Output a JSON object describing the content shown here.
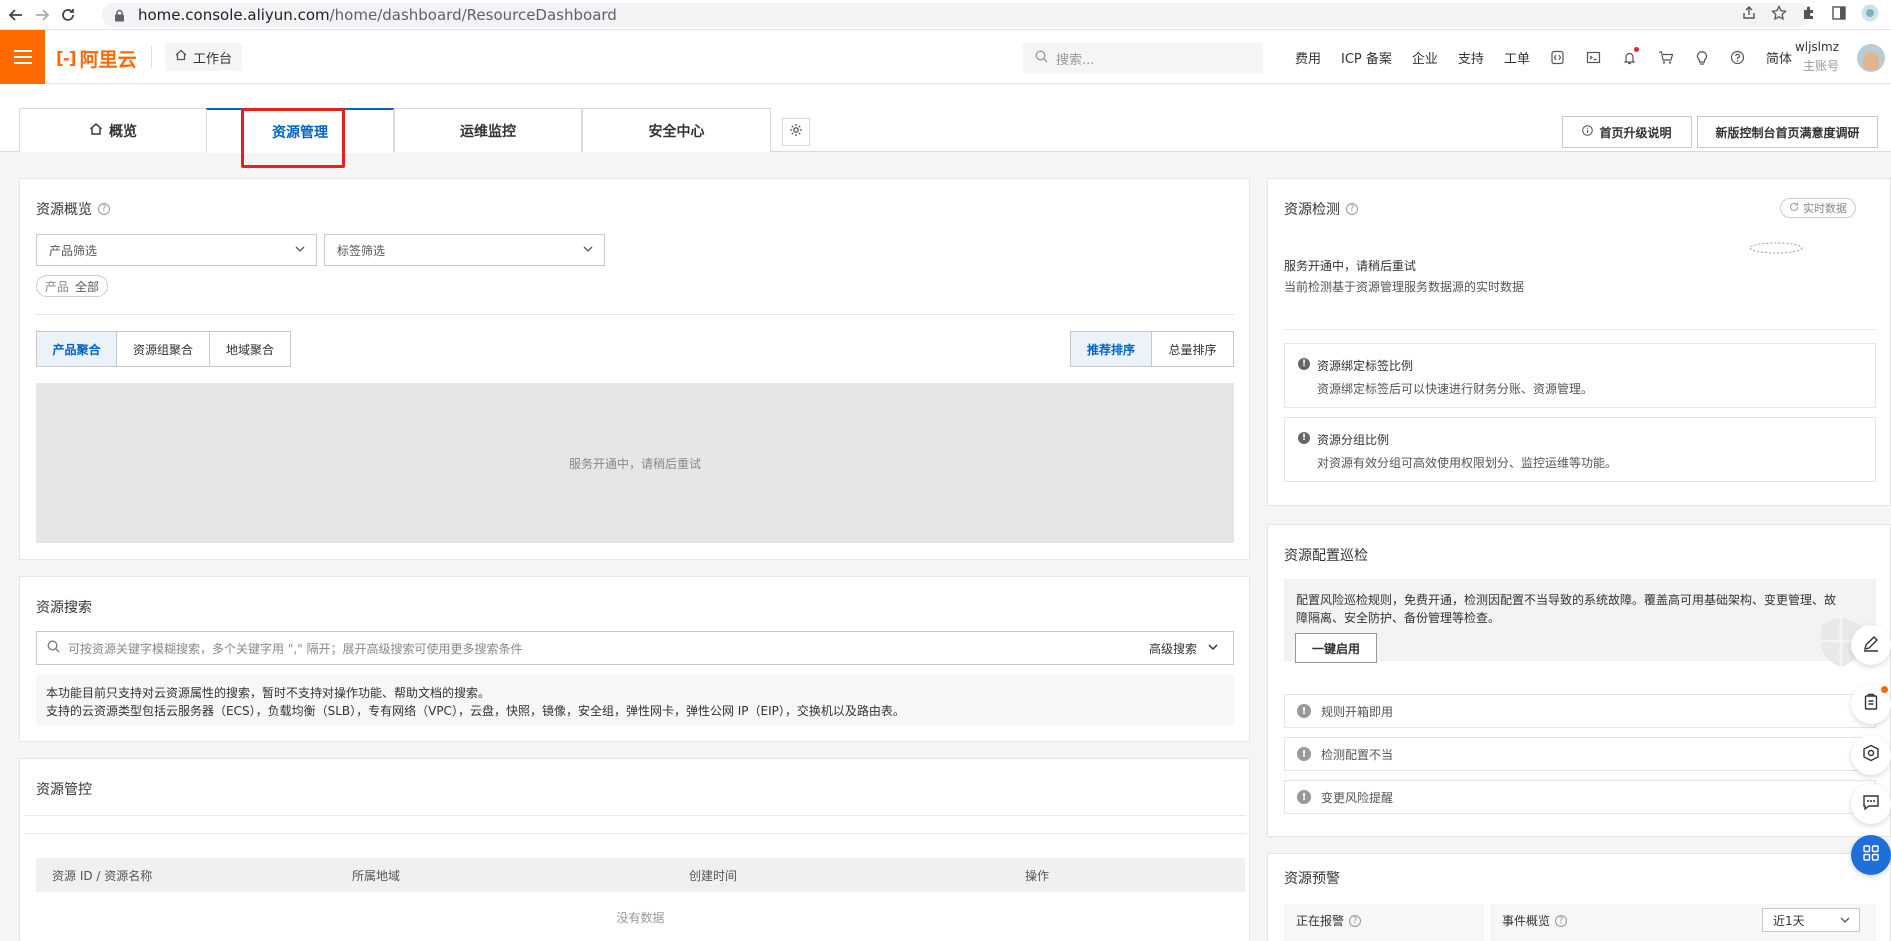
{
  "browser": {
    "url_domain": "home.console.aliyun.com",
    "url_path": "/home/dashboard/ResourceDashboard"
  },
  "topbar": {
    "logo_text": "阿里云",
    "workbench_label": "工作台",
    "search_placeholder": "搜索...",
    "nav_items": [
      "费用",
      "ICP 备案",
      "企业",
      "支持",
      "工单"
    ],
    "lang_label": "简体",
    "user_name": "wljslmz",
    "user_role": "主账号"
  },
  "tabs": {
    "overview": "概览",
    "resource_mgmt": "资源管理",
    "ops_monitor": "运维监控",
    "security_center": "安全中心",
    "upgrade_notes": "首页升级说明",
    "survey": "新版控制台首页满意度调研"
  },
  "resource_overview": {
    "title": "资源概览",
    "product_filter": "产品筛选",
    "tag_filter": "标签筛选",
    "chip_label": "产品",
    "chip_value": "全部",
    "group_tabs": [
      "产品聚合",
      "资源组聚合",
      "地域聚合"
    ],
    "sort_tabs": [
      "推荐排序",
      "总量排序"
    ],
    "empty_message": "服务开通中，请稍后重试"
  },
  "resource_search": {
    "title": "资源搜索",
    "placeholder": "可按资源关键字模糊搜索，多个关键字用 \",\" 隔开；展开高级搜索可使用更多搜索条件",
    "advanced_label": "高级搜索",
    "info_line1": "本功能目前只支持对云资源属性的搜索，暂时不支持对操作功能、帮助文档的搜索。",
    "info_line2": "支持的云资源类型包括云服务器（ECS），负载均衡（SLB），专有网络（VPC），云盘，快照，镜像，安全组，弹性网卡，弹性公网 IP（EIP），交换机以及路由表。"
  },
  "resource_control": {
    "title": "资源管控",
    "columns": [
      "资源 ID / 资源名称",
      "所属地域",
      "创建时间",
      "操作"
    ],
    "empty_message": "没有数据"
  },
  "resource_check": {
    "title": "资源检测",
    "realtime_label": "实时数据",
    "status_line": "服务开通中，请稍后重试",
    "basis_line": "当前检测基于资源管理服务数据源的实时数据",
    "items": [
      {
        "title": "资源绑定标签比例",
        "desc": "资源绑定标签后可以快速进行财务分账、资源管理。"
      },
      {
        "title": "资源分组比例",
        "desc": "对资源有效分组可高效使用权限划分、监控运维等功能。"
      }
    ]
  },
  "config_inspection": {
    "title": "资源配置巡检",
    "desc_line1": "配置风险巡检规则，免费开通，检测因配置不当导致的系统故障。覆盖高可用基础架构、变更管理、故",
    "desc_line2": "障隔离、安全防护、备份管理等检查。",
    "enable_button": "一键启用",
    "rows": [
      "规则开箱即用",
      "检测配置不当",
      "变更风险提醒"
    ]
  },
  "resource_alert": {
    "title": "资源预警",
    "alerting_label": "正在报警",
    "events_label": "事件概览",
    "range_value": "近1天"
  },
  "colors": {
    "brand_orange": "#ff6a00",
    "primary_blue": "#0064c8",
    "annotation_red": "#e8201a"
  }
}
